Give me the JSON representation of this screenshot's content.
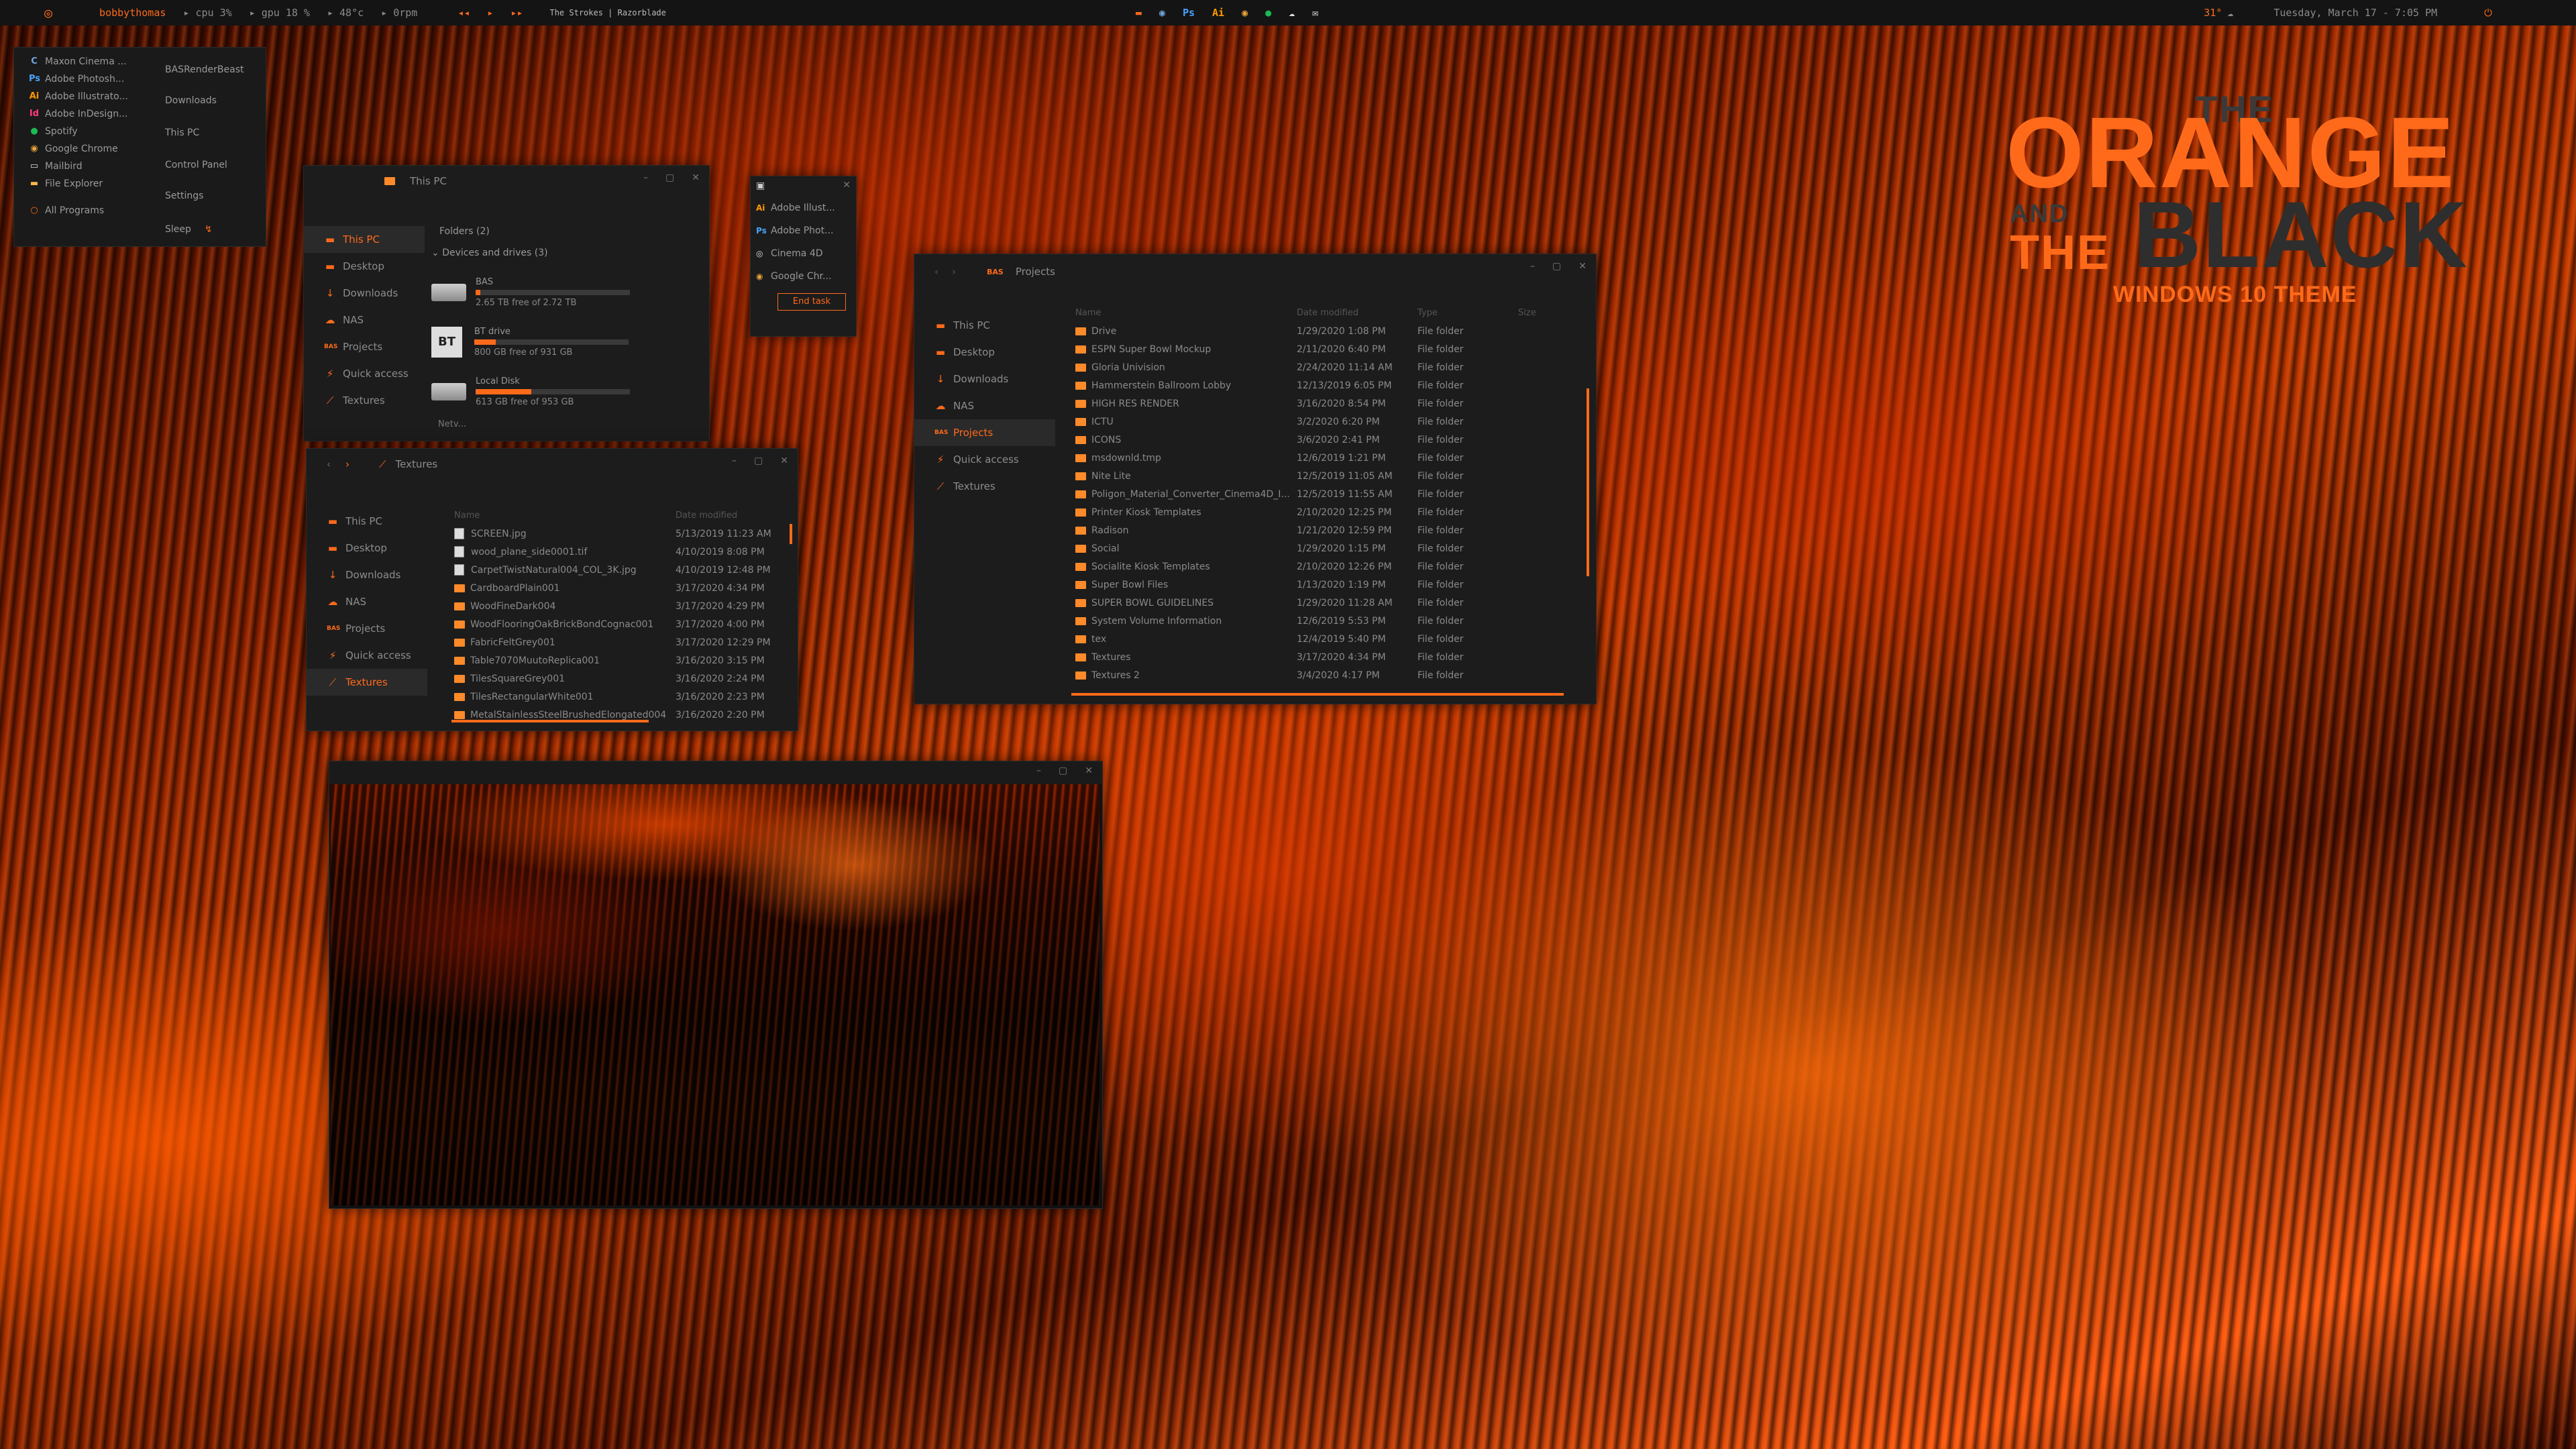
{
  "topbar": {
    "username": "bobbythomas",
    "cpu_label": "cpu",
    "cpu_value": "3%",
    "gpu_label": "gpu",
    "gpu_value": "18 %",
    "temp": "48°c",
    "rpm": "0rpm",
    "now_playing": "The Strokes | Razorblade",
    "weather_temp": "31°",
    "datetime": "Tuesday, March 17 - 7:05 PM",
    "tray_icons": [
      "bookmark-icon",
      "chrome-icon",
      "ps-icon",
      "ai-icon",
      "chrome-icon",
      "spotify-icon",
      "cloud-icon",
      "mail-icon"
    ]
  },
  "start_menu": {
    "apps": [
      {
        "label": "Maxon Cinema ...",
        "icon": "C",
        "color": "#6fa8dc"
      },
      {
        "label": "Adobe Photosh...",
        "icon": "Ps",
        "color": "#4aa3ff"
      },
      {
        "label": "Adobe Illustrato...",
        "icon": "Ai",
        "color": "#ff9a00"
      },
      {
        "label": "Adobe InDesign...",
        "icon": "Id",
        "color": "#ff3b7f"
      },
      {
        "label": "Spotify",
        "icon": "●",
        "color": "#1db954"
      },
      {
        "label": "Google Chrome",
        "icon": "◉",
        "color": "#e8a33c"
      },
      {
        "label": "Mailbird",
        "icon": "▭",
        "color": "#ddd"
      },
      {
        "label": "File Explorer",
        "icon": "▬",
        "color": "#ffb74d"
      }
    ],
    "all_programs": "All Programs",
    "right_links": [
      "BASRenderBeast",
      "Downloads",
      "This PC",
      "Control Panel",
      "Settings"
    ],
    "sleep": "Sleep"
  },
  "thispc": {
    "title": "This PC",
    "nav": [
      "This PC",
      "Desktop",
      "Downloads",
      "NAS",
      "Projects",
      "Quick access",
      "Textures"
    ],
    "folders_header": "Folders (2)",
    "devices_header": "Devices and drives (3)",
    "drives": [
      {
        "name": "BAS",
        "free": "2.65 TB free of 2.72 TB",
        "fill": 0.03,
        "icon": "hdd"
      },
      {
        "name": "BT drive",
        "free": "800 GB free of 931 GB",
        "fill": 0.14,
        "icon": "BT"
      },
      {
        "name": "Local Disk",
        "free": "613 GB free of 953 GB",
        "fill": 0.36,
        "icon": "hdd"
      }
    ],
    "footer": "Netv..."
  },
  "taskmgr": {
    "items": [
      "Adobe Illust...",
      "Adobe Phot...",
      "Cinema 4D",
      "Google Chr..."
    ],
    "end_task": "End task"
  },
  "textures": {
    "title": "Textures",
    "nav": [
      "This PC",
      "Desktop",
      "Downloads",
      "NAS",
      "Projects",
      "Quick access",
      "Textures"
    ],
    "col_name": "Name",
    "col_date": "Date modified",
    "files": [
      {
        "name": "SCREEN.jpg",
        "date": "5/13/2019 11:23 AM",
        "type": "file"
      },
      {
        "name": "wood_plane_side0001.tif",
        "date": "4/10/2019 8:08 PM",
        "type": "file"
      },
      {
        "name": "CarpetTwistNatural004_COL_3K.jpg",
        "date": "4/10/2019 12:48 PM",
        "type": "file"
      },
      {
        "name": "CardboardPlain001",
        "date": "3/17/2020 4:34 PM",
        "type": "folder"
      },
      {
        "name": "WoodFineDark004",
        "date": "3/17/2020 4:29 PM",
        "type": "folder"
      },
      {
        "name": "WoodFlooringOakBrickBondCognac001",
        "date": "3/17/2020 4:00 PM",
        "type": "folder"
      },
      {
        "name": "FabricFeltGrey001",
        "date": "3/17/2020 12:29 PM",
        "type": "folder"
      },
      {
        "name": "Table7070MuutoReplica001",
        "date": "3/16/2020 3:15 PM",
        "type": "folder"
      },
      {
        "name": "TilesSquareGrey001",
        "date": "3/16/2020 2:24 PM",
        "type": "folder"
      },
      {
        "name": "TilesRectangularWhite001",
        "date": "3/16/2020 2:23 PM",
        "type": "folder"
      },
      {
        "name": "MetalStainlessSteelBrushedElongated004",
        "date": "3/16/2020 2:20 PM",
        "type": "folder"
      }
    ]
  },
  "projects": {
    "title": "Projects",
    "nav": [
      "This PC",
      "Desktop",
      "Downloads",
      "NAS",
      "Projects",
      "Quick access",
      "Textures"
    ],
    "col_name": "Name",
    "col_date": "Date modified",
    "col_type": "Type",
    "col_size": "Size",
    "files": [
      {
        "name": "Drive",
        "date": "1/29/2020 1:08 PM",
        "type": "File folder"
      },
      {
        "name": "ESPN Super Bowl Mockup",
        "date": "2/11/2020 6:40 PM",
        "type": "File folder"
      },
      {
        "name": "Gloria Univision",
        "date": "2/24/2020 11:14 AM",
        "type": "File folder"
      },
      {
        "name": "Hammerstein Ballroom Lobby",
        "date": "12/13/2019 6:05 PM",
        "type": "File folder"
      },
      {
        "name": "HIGH RES RENDER",
        "date": "3/16/2020 8:54 PM",
        "type": "File folder"
      },
      {
        "name": "ICTU",
        "date": "3/2/2020 6:20 PM",
        "type": "File folder"
      },
      {
        "name": "ICONS",
        "date": "3/6/2020 2:41 PM",
        "type": "File folder"
      },
      {
        "name": "msdownld.tmp",
        "date": "12/6/2019 1:21 PM",
        "type": "File folder"
      },
      {
        "name": "Nite Lite",
        "date": "12/5/2019 11:05 AM",
        "type": "File folder"
      },
      {
        "name": "Poligon_Material_Converter_Cinema4D_I...",
        "date": "12/5/2019 11:55 AM",
        "type": "File folder"
      },
      {
        "name": "Printer Kiosk Templates",
        "date": "2/10/2020 12:25 PM",
        "type": "File folder"
      },
      {
        "name": "Radison",
        "date": "1/21/2020 12:59 PM",
        "type": "File folder"
      },
      {
        "name": "Social",
        "date": "1/29/2020 1:15 PM",
        "type": "File folder"
      },
      {
        "name": "Socialite Kiosk Templates",
        "date": "2/10/2020 12:26 PM",
        "type": "File folder"
      },
      {
        "name": "Super Bowl Files",
        "date": "1/13/2020 1:19 PM",
        "type": "File folder"
      },
      {
        "name": "SUPER BOWL GUIDELINES",
        "date": "1/29/2020 11:28 AM",
        "type": "File folder"
      },
      {
        "name": "System Volume Information",
        "date": "12/6/2019 5:53 PM",
        "type": "File folder"
      },
      {
        "name": "tex",
        "date": "12/4/2019 5:40 PM",
        "type": "File folder"
      },
      {
        "name": "Textures",
        "date": "3/17/2020 4:34 PM",
        "type": "File folder"
      },
      {
        "name": "Textures 2",
        "date": "3/4/2020 4:17 PM",
        "type": "File folder"
      }
    ]
  },
  "theme": {
    "line1": "THE",
    "line2": "ORANGE",
    "line3a": "AND",
    "line3b": "THE",
    "line3c": "BLACK",
    "subtitle": "WINDOWS 10 THEME"
  },
  "colors": {
    "accent": "#ff6a1a",
    "panel": "#1c1c1c",
    "bar": "#141414"
  }
}
